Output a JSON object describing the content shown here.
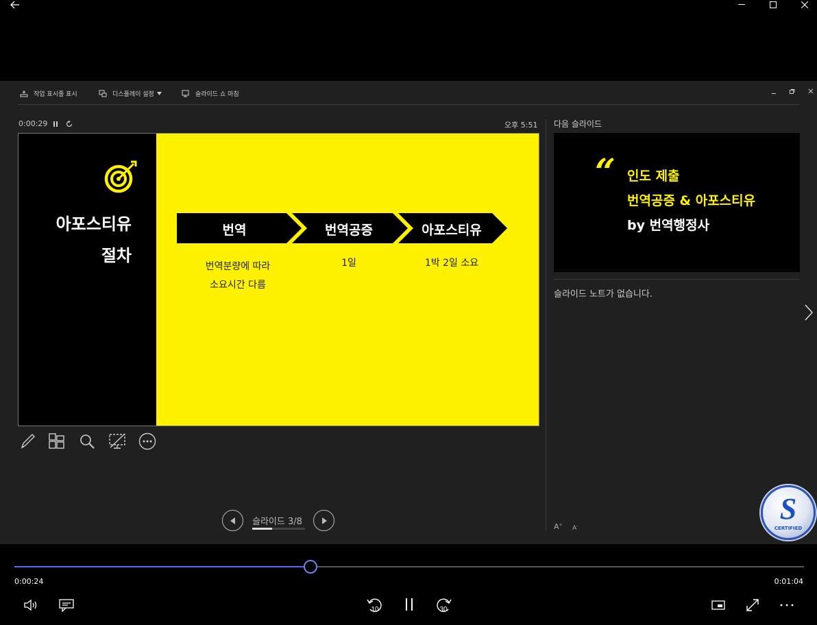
{
  "window": {
    "back_icon": "back-arrow-icon",
    "minimize_icon": "minimize-icon",
    "maximize_icon": "maximize-icon",
    "close_icon": "close-icon"
  },
  "toolbar": {
    "taskbar_label": "작업 표시줄 표시",
    "display_label": "디스플레이 설정",
    "end_show_label": "슬라이드 쇼 마침"
  },
  "timer": {
    "elapsed": "0:00:29",
    "clock": "오후 5:51"
  },
  "current_slide": {
    "title_line1": "아포스티유",
    "title_line2": "절차",
    "accent_color": "#fff200",
    "steps": [
      {
        "label": "번역",
        "desc_line1": "번역분량에 따라",
        "desc_line2": "소요시간 다름"
      },
      {
        "label": "번역공증",
        "desc_line1": "1일",
        "desc_line2": ""
      },
      {
        "label": "아포스티유",
        "desc_line1": "1박 2일 소요",
        "desc_line2": ""
      }
    ]
  },
  "next_slide": {
    "header": "다음 슬라이드",
    "quote_mark": "“",
    "line1": "인도 제출",
    "line2": "번역공증 & 아포스티유",
    "line3": "by 번역행정사"
  },
  "notes": {
    "text": "슬라이드 노트가 없습니다."
  },
  "navigation": {
    "slide_label": "슬라이드 3/8",
    "progress": 0.375
  },
  "font_size_buttons": {
    "increase": "A",
    "decrease": "A"
  },
  "badge": {
    "letter": "S",
    "text": "CERTIFIED"
  },
  "media": {
    "current_time": "0:00:24",
    "total_time": "0:01:04",
    "progress": 0.375,
    "skip_back": "10",
    "skip_forward": "30",
    "accent_color": "#4f6bed"
  }
}
